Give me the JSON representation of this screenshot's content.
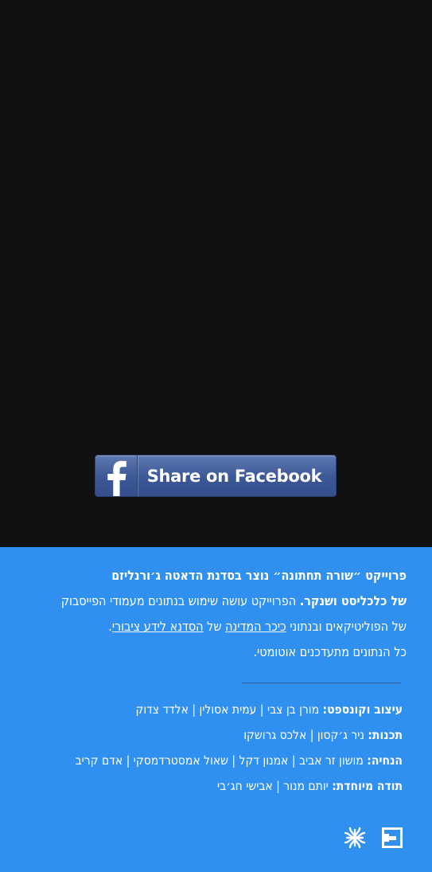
{
  "share": {
    "label": "Share on Facebook",
    "icon": "facebook-f-icon",
    "color": "#3b5796"
  },
  "about": {
    "line1_bold": "פרוייקט ״שורה תחתונה״ נוצר בסדנת הדאטה ג׳ורנליזם",
    "line2_bold": "של כלכליסט ושנקר.",
    "line2_rest": " הפרוייקט עושה שימוש בנתונים מעמודי הפייסבוק",
    "line3_pre": "של הפוליטיקאים ובנתוני ",
    "link_kikar": "כיכר המדינה",
    "line3_mid": " של ",
    "link_sadna": "הסדנא לידע ציבורי",
    "line3_end": ".",
    "line4": "כל הנתונים מתעדכנים אוטומטי."
  },
  "credits": [
    {
      "label": "עיצוב וקונספט:",
      "names": "מורן בן צבי | עמית אסולין | אלדד צדוק"
    },
    {
      "label": "תכנות:",
      "names": "ניר ג׳קסון | אלכס גרושקו"
    },
    {
      "label": "הנחיה:",
      "names": "מושון זר אביב | אמנון דקל | שאול אמסטרדמסקי | אדם קריב"
    },
    {
      "label": "תודה מיוחדת:",
      "names": "יותם מנור | אבישי חג׳בי"
    }
  ],
  "colors": {
    "top_background": "#111111",
    "footer_background": "#3090f0",
    "text": "#ffffff"
  },
  "logos": {
    "left": "shenkar-knot-icon",
    "right": "calcalist-logo-icon"
  }
}
